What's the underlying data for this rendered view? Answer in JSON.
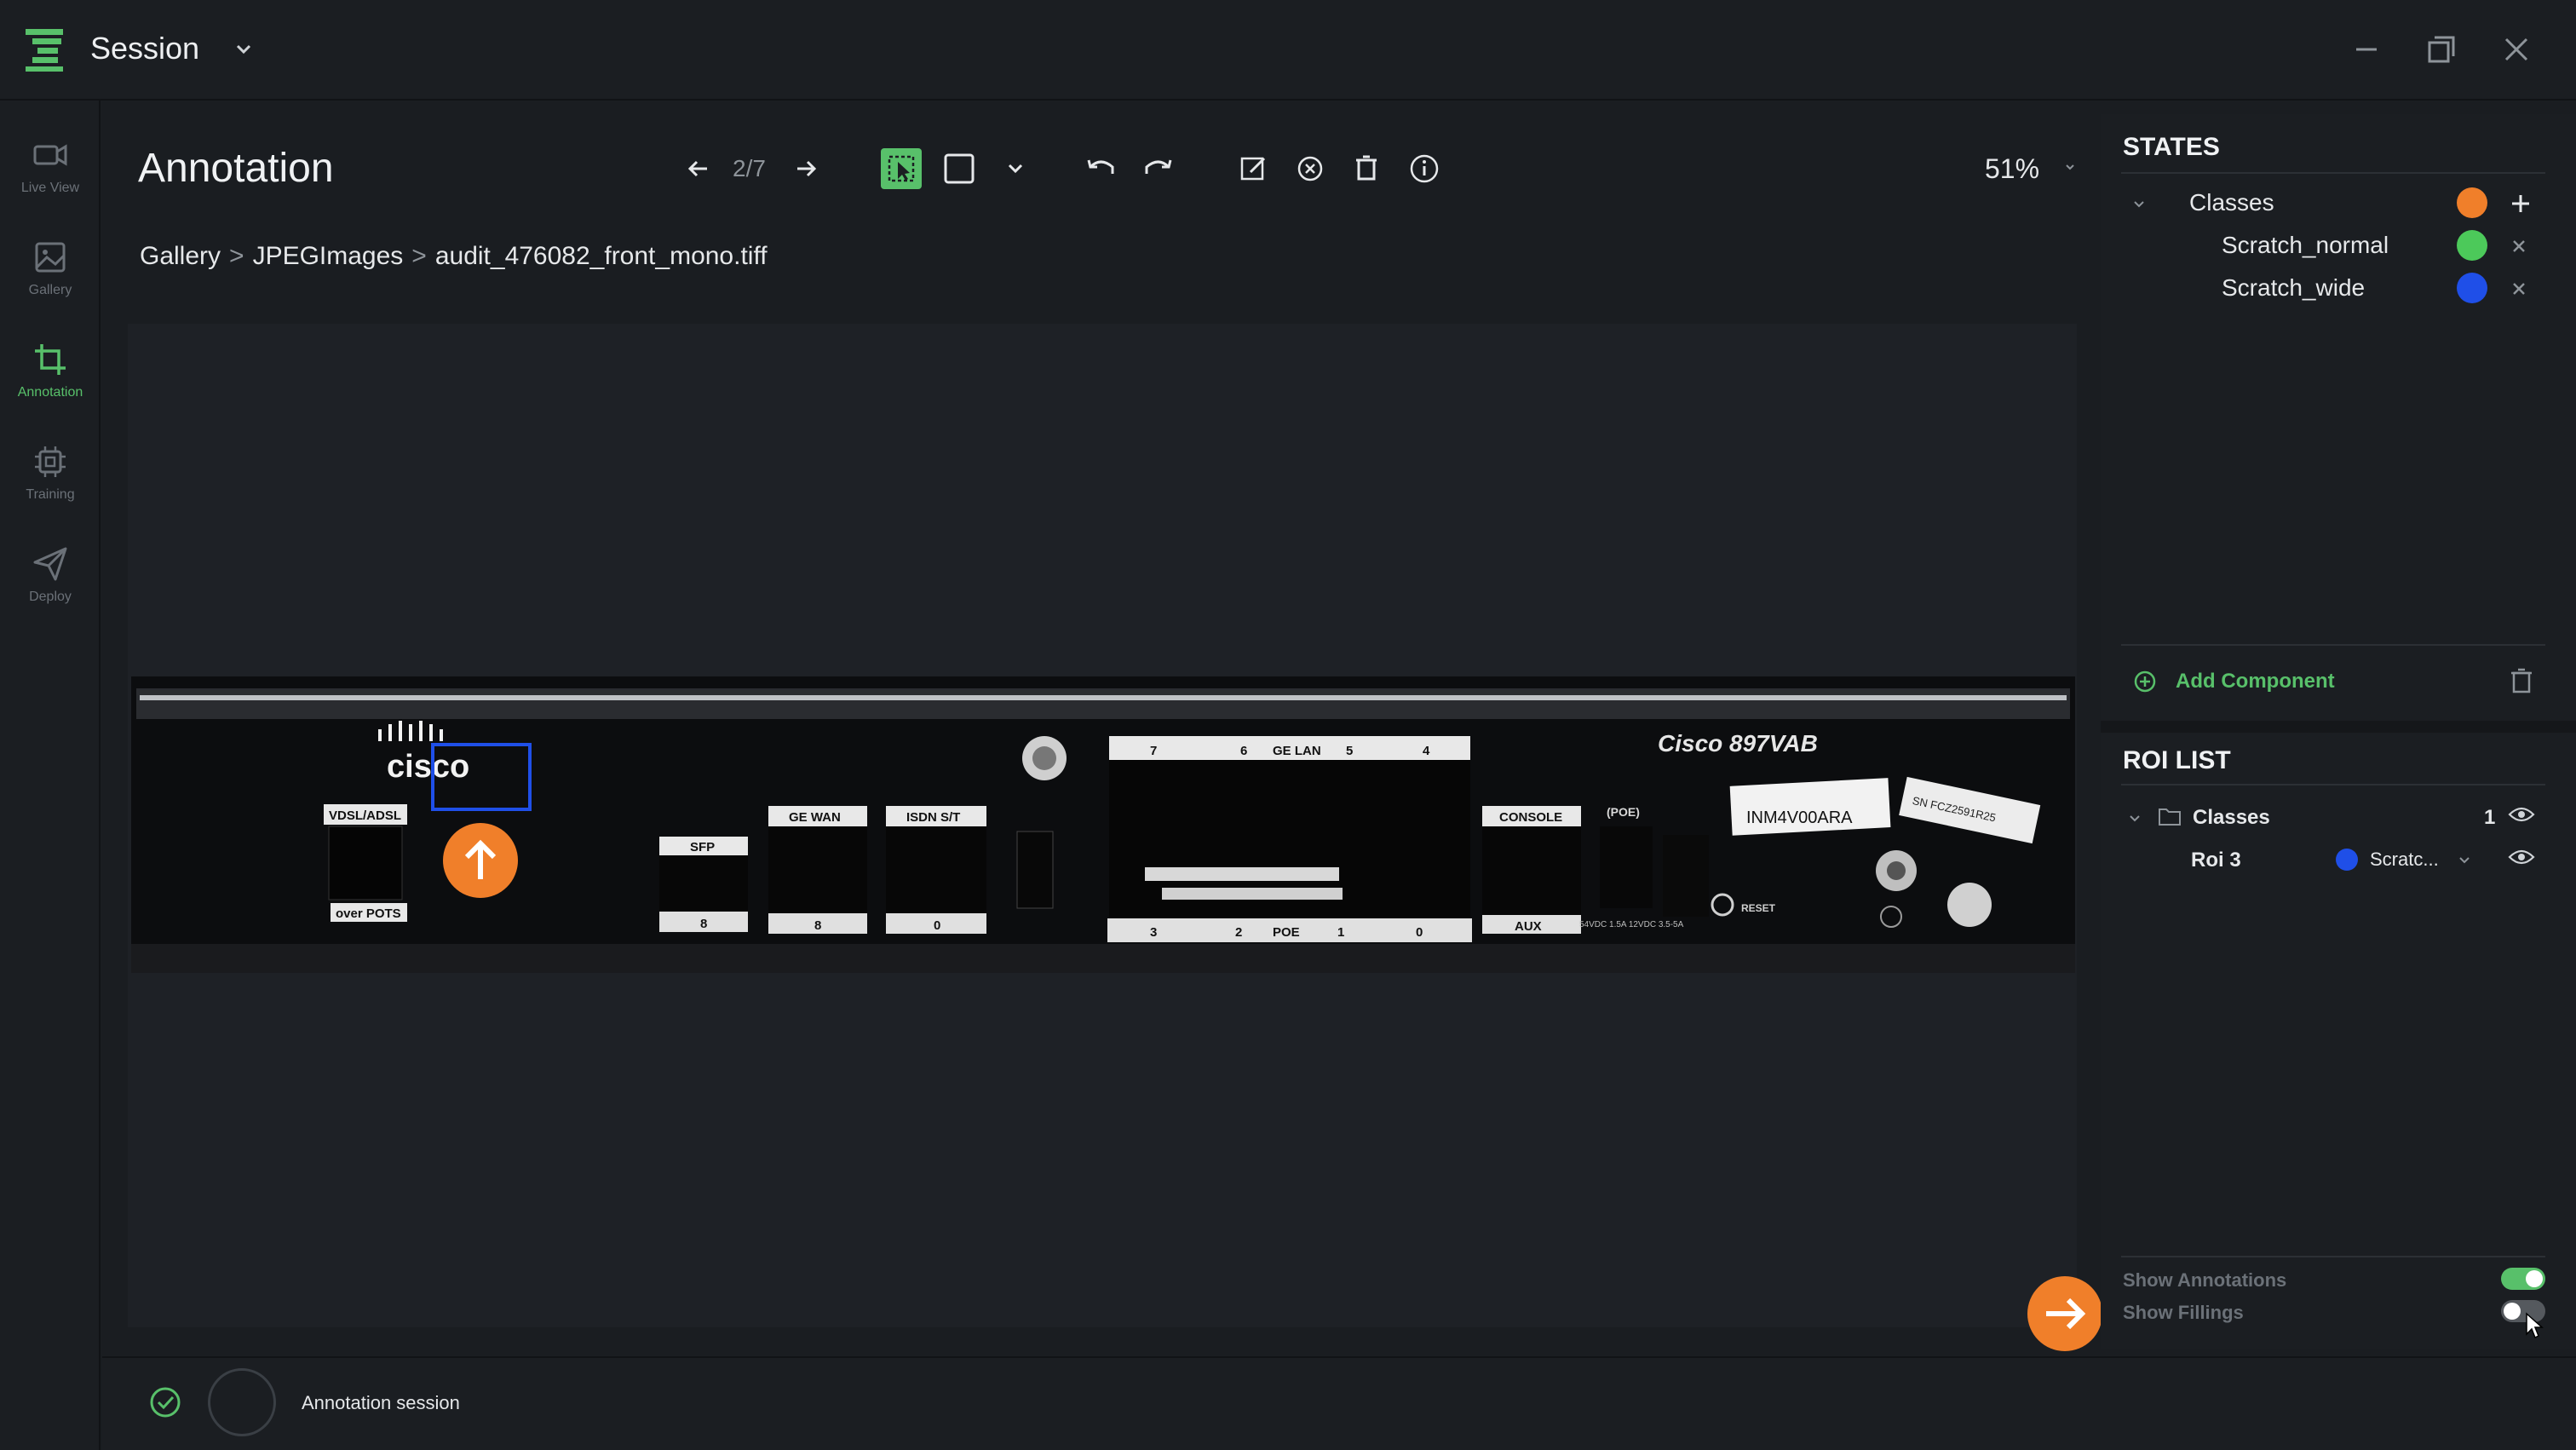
{
  "window": {
    "title": "Session"
  },
  "nav": {
    "items": [
      {
        "label": "Live View",
        "icon": "video-camera-icon",
        "active": false
      },
      {
        "label": "Gallery",
        "icon": "image-icon",
        "active": false
      },
      {
        "label": "Annotation",
        "icon": "crop-icon",
        "active": true
      },
      {
        "label": "Training",
        "icon": "cpu-chip-icon",
        "active": false
      },
      {
        "label": "Deploy",
        "icon": "paper-plane-icon",
        "active": false
      }
    ]
  },
  "toolbar": {
    "page_title": "Annotation",
    "page_indicator": "2/7",
    "zoom": "51%"
  },
  "breadcrumb": {
    "items": [
      "Gallery",
      "JPEGImages",
      "audit_476082_front_mono.tiff"
    ],
    "separator": ">"
  },
  "image": {
    "brand": "cisco",
    "model_label": "Cisco 897VAB",
    "port_labels": [
      "VDSL/ADSL",
      "over POTS",
      "SFP",
      "GE WAN",
      "ISDN S/T",
      "CONSOLE",
      "AUX",
      "(POE)",
      "RESET",
      "GE LAN",
      "POE"
    ],
    "port_numbers_bottom": [
      "8",
      "8",
      "0",
      "3",
      "2",
      "1",
      "0"
    ],
    "port_numbers_top": [
      "7",
      "6",
      "5",
      "4"
    ],
    "barcode_text": "INM4V00ARA",
    "serial_sticker": "SN FCZ2591R25",
    "power_text": "54VDC 1.5A  12VDC 3.5-5A"
  },
  "states_panel": {
    "heading": "STATES",
    "root_label": "Classes",
    "root_color": "#f07f2a",
    "classes": [
      {
        "name": "Scratch_normal",
        "color": "#4cc95a"
      },
      {
        "name": "Scratch_wide",
        "color": "#1f4fe8"
      }
    ],
    "add_component_label": "Add Component"
  },
  "roi_panel": {
    "heading": "ROI LIST",
    "group_label": "Classes",
    "group_count": "1",
    "rois": [
      {
        "name": "Roi 3",
        "class": "Scratc...",
        "color": "#1f4fe8"
      }
    ]
  },
  "toggles": {
    "show_annotations_label": "Show Annotations",
    "show_annotations_on": true,
    "show_fillings_label": "Show Fillings",
    "show_fillings_on": false
  },
  "status": {
    "text": "Annotation session"
  },
  "colors": {
    "accent": "#58c06a",
    "orange": "#f07f2a",
    "annotation_box": "#1f4fe8"
  }
}
